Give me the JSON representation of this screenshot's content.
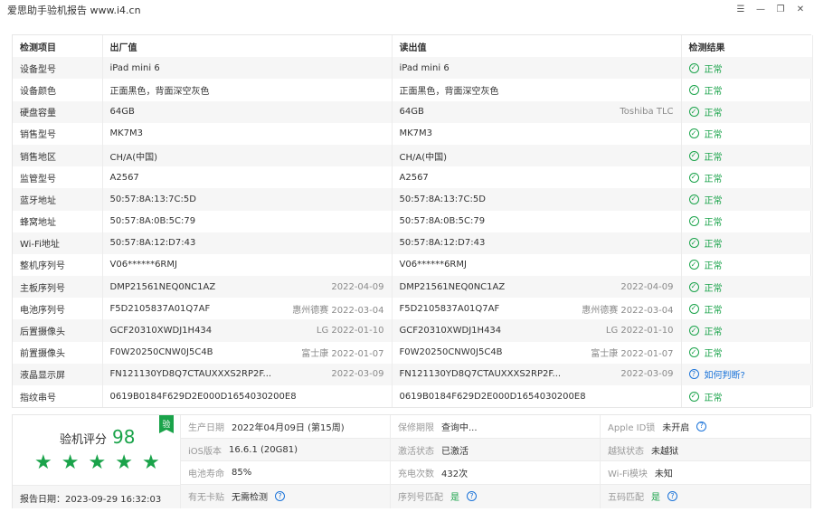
{
  "window": {
    "title": "爱思助手验机报告 www.i4.cn",
    "icons": [
      "list-icon",
      "minimize-icon",
      "restore-icon",
      "close-icon"
    ]
  },
  "table": {
    "headers": [
      "检测项目",
      "出厂值",
      "读出值",
      "检测结果"
    ],
    "rows": [
      {
        "item": "设备型号",
        "factory": "iPad mini 6",
        "factory_note": "",
        "read": "iPad mini 6",
        "read_note": "",
        "result": "正常",
        "status": "ok"
      },
      {
        "item": "设备颜色",
        "factory": "正面黑色，背面深空灰色",
        "factory_note": "",
        "read": "正面黑色，背面深空灰色",
        "read_note": "",
        "result": "正常",
        "status": "ok"
      },
      {
        "item": "硬盘容量",
        "factory": "64GB",
        "factory_note": "",
        "read": "64GB",
        "read_note": "Toshiba TLC",
        "result": "正常",
        "status": "ok"
      },
      {
        "item": "销售型号",
        "factory": "MK7M3",
        "factory_note": "",
        "read": "MK7M3",
        "read_note": "",
        "result": "正常",
        "status": "ok"
      },
      {
        "item": "销售地区",
        "factory": "CH/A(中国)",
        "factory_note": "",
        "read": "CH/A(中国)",
        "read_note": "",
        "result": "正常",
        "status": "ok"
      },
      {
        "item": "监管型号",
        "factory": "A2567",
        "factory_note": "",
        "read": "A2567",
        "read_note": "",
        "result": "正常",
        "status": "ok"
      },
      {
        "item": "蓝牙地址",
        "factory": "50:57:8A:13:7C:5D",
        "factory_note": "",
        "read": "50:57:8A:13:7C:5D",
        "read_note": "",
        "result": "正常",
        "status": "ok"
      },
      {
        "item": "蜂窝地址",
        "factory": "50:57:8A:0B:5C:79",
        "factory_note": "",
        "read": "50:57:8A:0B:5C:79",
        "read_note": "",
        "result": "正常",
        "status": "ok"
      },
      {
        "item": "Wi-Fi地址",
        "factory": "50:57:8A:12:D7:43",
        "factory_note": "",
        "read": "50:57:8A:12:D7:43",
        "read_note": "",
        "result": "正常",
        "status": "ok"
      },
      {
        "item": "整机序列号",
        "factory": "V06******6RMJ",
        "factory_note": "",
        "read": "V06******6RMJ",
        "read_note": "",
        "result": "正常",
        "status": "ok"
      },
      {
        "item": "主板序列号",
        "factory": "DMP21561NEQ0NC1AZ",
        "factory_note": "2022-04-09",
        "read": "DMP21561NEQ0NC1AZ",
        "read_note": "2022-04-09",
        "result": "正常",
        "status": "ok"
      },
      {
        "item": "电池序列号",
        "factory": "F5D2105837A01Q7AF",
        "factory_note": "惠州德赛 2022-03-04",
        "read": "F5D2105837A01Q7AF",
        "read_note": "惠州德赛 2022-03-04",
        "result": "正常",
        "status": "ok"
      },
      {
        "item": "后置摄像头",
        "factory": "GCF20310XWDJ1H434",
        "factory_note": "LG 2022-01-10",
        "read": "GCF20310XWDJ1H434",
        "read_note": "LG 2022-01-10",
        "result": "正常",
        "status": "ok"
      },
      {
        "item": "前置摄像头",
        "factory": "F0W20250CNW0J5C4B",
        "factory_note": "富士康 2022-01-07",
        "read": "F0W20250CNW0J5C4B",
        "read_note": "富士康 2022-01-07",
        "result": "正常",
        "status": "ok"
      },
      {
        "item": "液晶显示屏",
        "factory": "FN121130YD8Q7CTAUXXXS2RP2F...",
        "factory_note": "2022-03-09",
        "read": "FN121130YD8Q7CTAUXXXS2RP2F...",
        "read_note": "2022-03-09",
        "result": "如何判断?",
        "status": "question"
      },
      {
        "item": "指纹串号",
        "factory": "0619B0184F629D2E000D1654030200E8",
        "factory_note": "",
        "read": "0619B0184F629D2E000D1654030200E8",
        "read_note": "",
        "result": "正常",
        "status": "ok"
      }
    ]
  },
  "summary": {
    "score_label": "验机评分",
    "score": "98",
    "badge": "验",
    "stars": 5,
    "report_date": "报告日期：2023-09-29 16:32:03",
    "info": [
      [
        {
          "k": "生产日期",
          "v": "2022年04月09日 (第15周)",
          "help": false,
          "green": false
        },
        {
          "k": "保修期限",
          "v": "查询中...",
          "help": false,
          "green": false
        },
        {
          "k": "Apple ID锁",
          "v": "未开启",
          "help": true,
          "green": false
        }
      ],
      [
        {
          "k": "iOS版本",
          "v": "16.6.1 (20G81)",
          "help": false,
          "green": false
        },
        {
          "k": "激活状态",
          "v": "已激活",
          "help": false,
          "green": false
        },
        {
          "k": "越狱状态",
          "v": "未越狱",
          "help": false,
          "green": false
        }
      ],
      [
        {
          "k": "电池寿命",
          "v": "85%",
          "help": false,
          "green": false
        },
        {
          "k": "充电次数",
          "v": "432次",
          "help": false,
          "green": false
        },
        {
          "k": "Wi-Fi模块",
          "v": "未知",
          "help": false,
          "green": false
        }
      ],
      [
        {
          "k": "有无卡贴",
          "v": "无需检测",
          "help": true,
          "green": false
        },
        {
          "k": "序列号匹配",
          "v": "是",
          "help": true,
          "green": true
        },
        {
          "k": "五码匹配",
          "v": "是",
          "help": true,
          "green": true
        }
      ]
    ]
  }
}
